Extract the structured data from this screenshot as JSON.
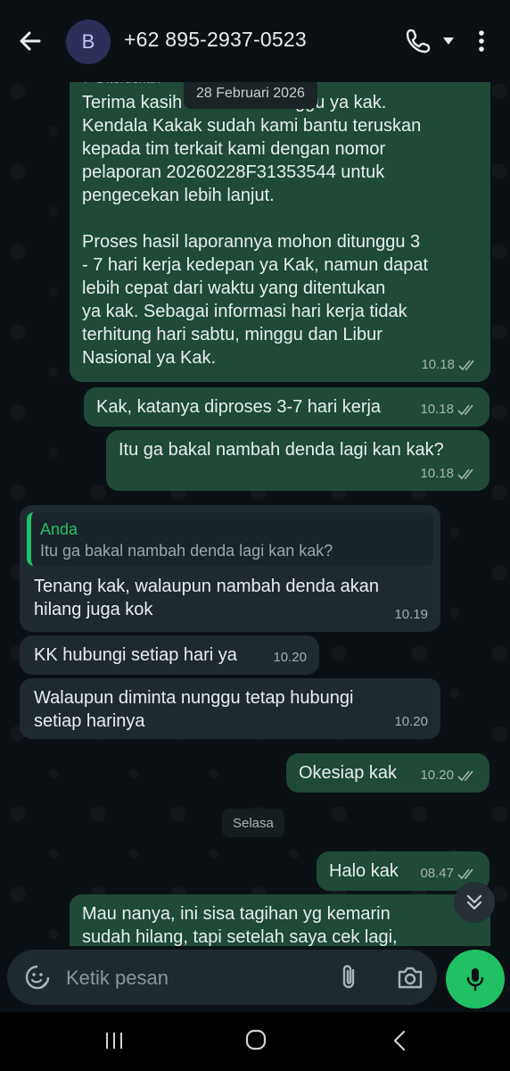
{
  "header": {
    "avatar_initial": "B",
    "contact_name": "+62 895-2937-0523"
  },
  "chat": {
    "date_label": "28 Februari 2026",
    "day_label": "Selasa",
    "forwarded_label": "Diteruskan",
    "messages": [
      {
        "direction": "outgoing",
        "text": "Terima kasih sudah menunggu ya kak.\nKendala Kakak sudah kami bantu teruskan\nkepada tim terkait kami dengan nomor\npelaporan 20260228F31353544 untuk\npengecekan lebih lanjut.\n\nProses hasil laporannya mohon ditunggu 3\n- 7 hari kerja kedepan ya Kak, namun dapat\nlebih cepat dari waktu yang ditentukan\nya kak. Sebagai informasi hari kerja tidak\nterhitung hari sabtu, minggu dan Libur\nNasional ya Kak.",
        "time": "10.18",
        "status": "read"
      },
      {
        "direction": "outgoing",
        "text": "Kak, katanya diproses 3-7 hari kerja",
        "time": "10.18",
        "status": "read"
      },
      {
        "direction": "outgoing",
        "text": "Itu ga bakal nambah denda lagi kan kak?",
        "time": "10.18",
        "status": "read"
      },
      {
        "direction": "incoming",
        "quote_author": "Anda",
        "quote_text": "Itu ga bakal nambah denda lagi kan kak?",
        "text": "Tenang kak, walaupun nambah denda akan\nhilang juga kok",
        "time": "10.19"
      },
      {
        "direction": "incoming",
        "text": "KK hubungi setiap hari ya",
        "time": "10.20"
      },
      {
        "direction": "incoming",
        "text": "Walaupun diminta nunggu tetap hubungi\nsetiap harinya",
        "time": "10.20"
      },
      {
        "direction": "outgoing",
        "text": "Okesiap kak",
        "time": "10.20",
        "status": "read"
      },
      {
        "direction": "outgoing",
        "text": "Halo kak",
        "time": "08.47",
        "status": "read"
      },
      {
        "direction": "outgoing",
        "text": "Mau nanya, ini sisa tagihan yg kemarin\nsudah hilang, tapi setelah saya cek lagi,",
        "time": "",
        "status": ""
      }
    ]
  },
  "input": {
    "placeholder": "Ketik pesan"
  },
  "icons": {
    "back": "arrow-left-icon",
    "call": "phone-icon",
    "menu": "more-vertical-icon",
    "emoji": "emoji-icon",
    "attach": "paperclip-icon",
    "camera": "camera-icon",
    "mic": "microphone-icon",
    "scroll_down": "chevrons-down-icon"
  },
  "colors": {
    "accent": "#21c063",
    "outgoing_bubble": "#1e4a37",
    "incoming_bubble": "#1f2a30",
    "background": "#0b1014"
  }
}
